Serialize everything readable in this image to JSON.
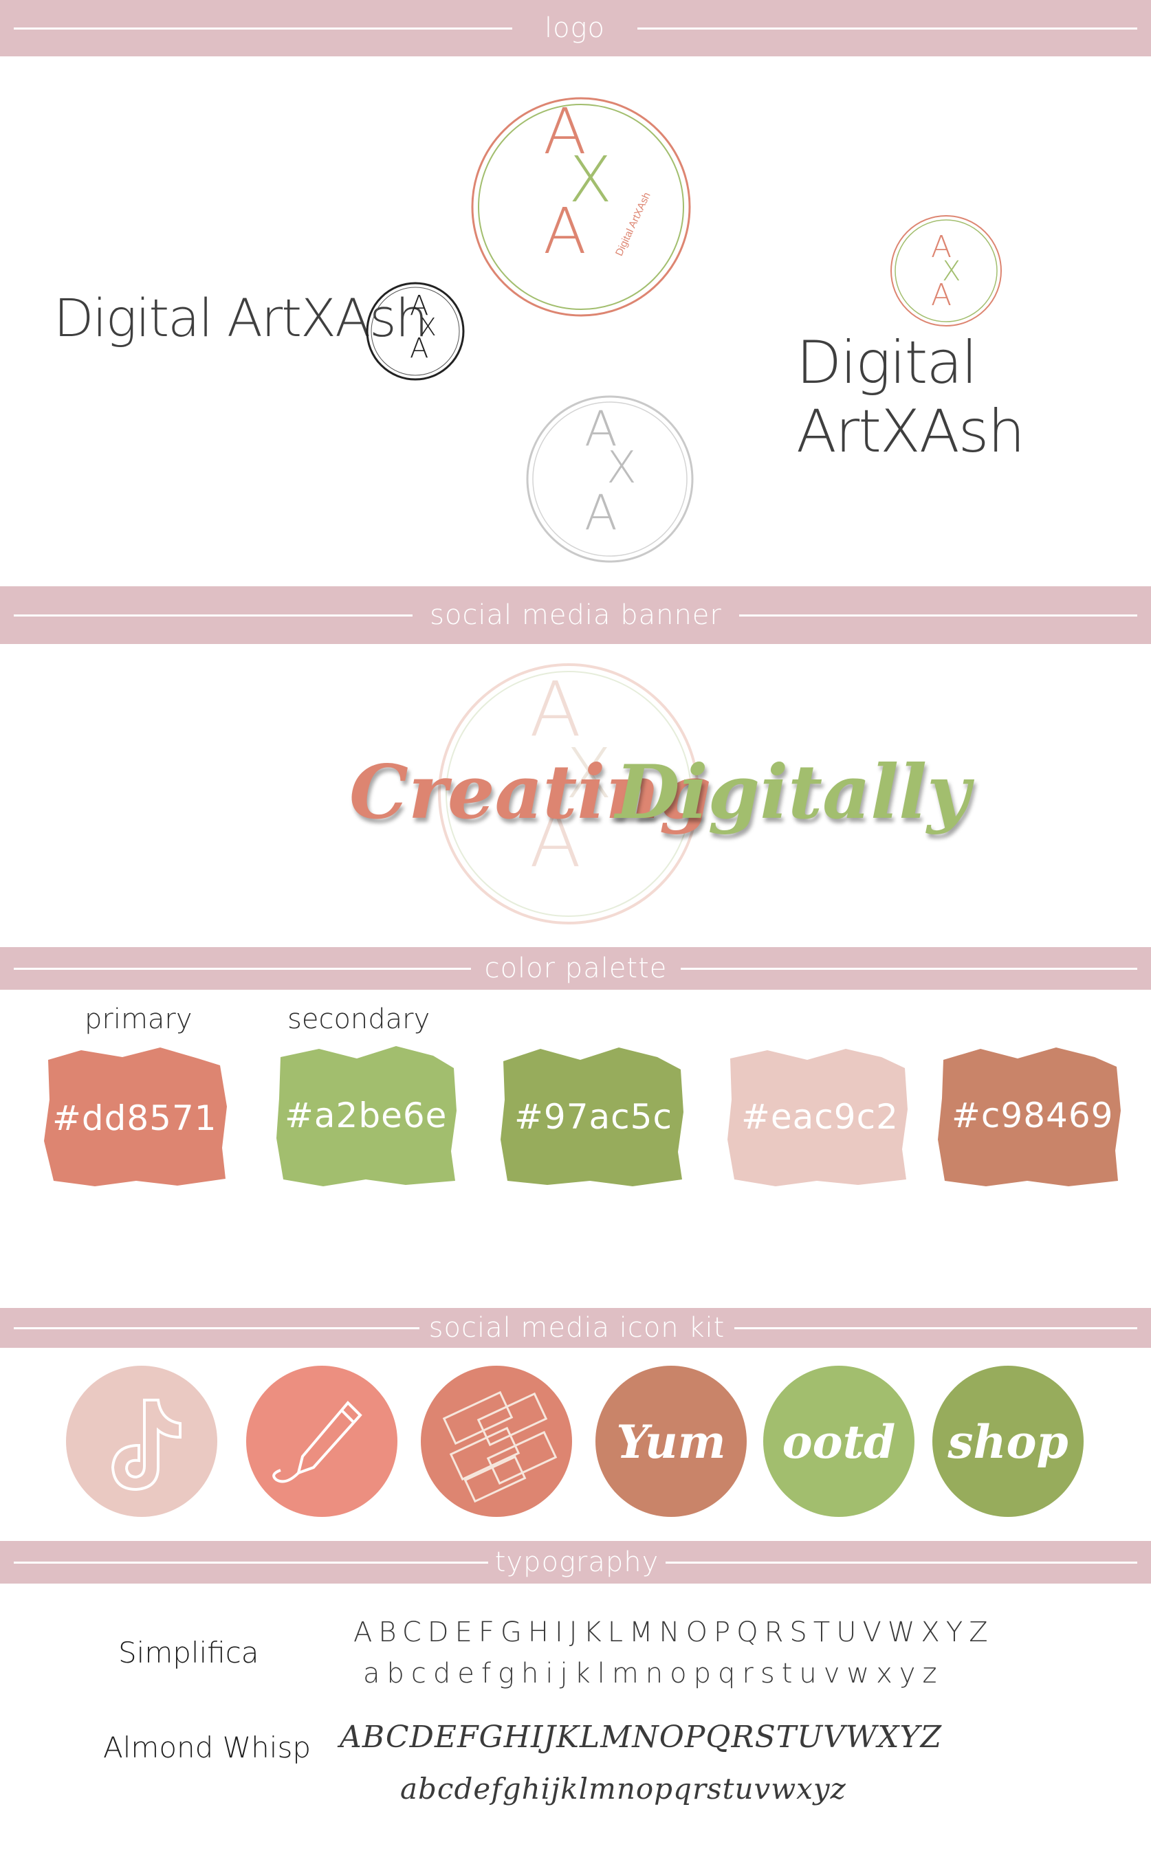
{
  "sections": {
    "logo": "logo",
    "banner": "social media banner",
    "palette": "color palette",
    "icons": "social media icon kit",
    "typography": "typography"
  },
  "logo": {
    "brand_name": "Digital ArtXAsh",
    "monogram": [
      "A",
      "X",
      "A"
    ],
    "circle_caption": "Digital ArtXAsh"
  },
  "banner": {
    "word1": "Creating",
    "word2": "Digitally"
  },
  "palette": {
    "primary_label": "primary",
    "secondary_label": "secondary",
    "colors": [
      {
        "hex": "#dd8571",
        "color": "#dd8571"
      },
      {
        "hex": "#a2be6e",
        "color": "#a2be6e"
      },
      {
        "hex": "#97ac5c",
        "color": "#97ac5c"
      },
      {
        "hex": "#eac9c2",
        "color": "#eac9c2"
      },
      {
        "hex": "#c98469",
        "color": "#c98469"
      }
    ]
  },
  "icon_kit": [
    {
      "icon": "tiktok-icon",
      "color": "#eac9c2"
    },
    {
      "icon": "pen-icon",
      "color": "#ec8f80"
    },
    {
      "icon": "rectangles-icon",
      "color": "#dd8571"
    },
    {
      "label": "Yum",
      "color": "#c98469"
    },
    {
      "label": "ootd",
      "color": "#a2be6e"
    },
    {
      "label": "shop",
      "color": "#97ac5c"
    }
  ],
  "typography": {
    "font1_name": "Simplifica",
    "font1_upper": "ABCDEFGHIJKLMNOPQRSTUVWXYZ",
    "font1_lower": "abcdefghijklmnopqrstuvwxyz",
    "font2_name": "Almond Whisp",
    "font2_upper": "ABCDEFGHIJKLMNOPQRSTUVWXYZ",
    "font2_lower": "abcdefghijklmnopqrstuvwxyz"
  }
}
